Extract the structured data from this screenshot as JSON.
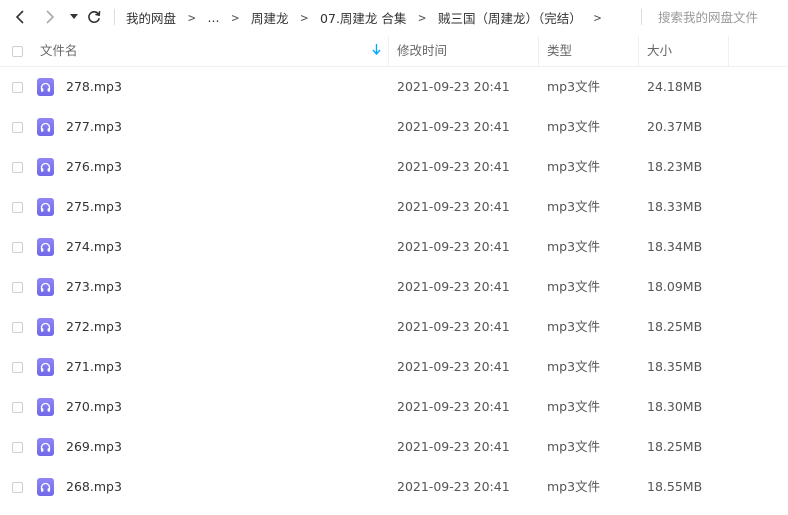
{
  "nav": {
    "back_icon": "chevron-left-icon",
    "forward_icon": "chevron-right-icon",
    "dropdown_icon": "caret-down-icon",
    "refresh_icon": "refresh-icon"
  },
  "breadcrumb": {
    "items": [
      "我的网盘",
      "...",
      "周建龙",
      "07.周建龙 合集",
      "贼三国（周建龙）（完结）"
    ],
    "separator": ">"
  },
  "search": {
    "placeholder": "搜索我的网盘文件"
  },
  "table": {
    "columns": {
      "name": "文件名",
      "modified": "修改时间",
      "type": "类型",
      "size": "大小"
    },
    "sort_icon": "sort-down-arrow-icon",
    "rows": [
      {
        "name": "278.mp3",
        "modified": "2021-09-23 20:41",
        "type": "mp3文件",
        "size": "24.18MB"
      },
      {
        "name": "277.mp3",
        "modified": "2021-09-23 20:41",
        "type": "mp3文件",
        "size": "20.37MB"
      },
      {
        "name": "276.mp3",
        "modified": "2021-09-23 20:41",
        "type": "mp3文件",
        "size": "18.23MB"
      },
      {
        "name": "275.mp3",
        "modified": "2021-09-23 20:41",
        "type": "mp3文件",
        "size": "18.33MB"
      },
      {
        "name": "274.mp3",
        "modified": "2021-09-23 20:41",
        "type": "mp3文件",
        "size": "18.34MB"
      },
      {
        "name": "273.mp3",
        "modified": "2021-09-23 20:41",
        "type": "mp3文件",
        "size": "18.09MB"
      },
      {
        "name": "272.mp3",
        "modified": "2021-09-23 20:41",
        "type": "mp3文件",
        "size": "18.25MB"
      },
      {
        "name": "271.mp3",
        "modified": "2021-09-23 20:41",
        "type": "mp3文件",
        "size": "18.35MB"
      },
      {
        "name": "270.mp3",
        "modified": "2021-09-23 20:41",
        "type": "mp3文件",
        "size": "18.30MB"
      },
      {
        "name": "269.mp3",
        "modified": "2021-09-23 20:41",
        "type": "mp3文件",
        "size": "18.25MB"
      },
      {
        "name": "268.mp3",
        "modified": "2021-09-23 20:41",
        "type": "mp3文件",
        "size": "18.55MB"
      }
    ]
  },
  "colors": {
    "accent": "#06a7ff",
    "file_icon": "#7d74ee"
  }
}
